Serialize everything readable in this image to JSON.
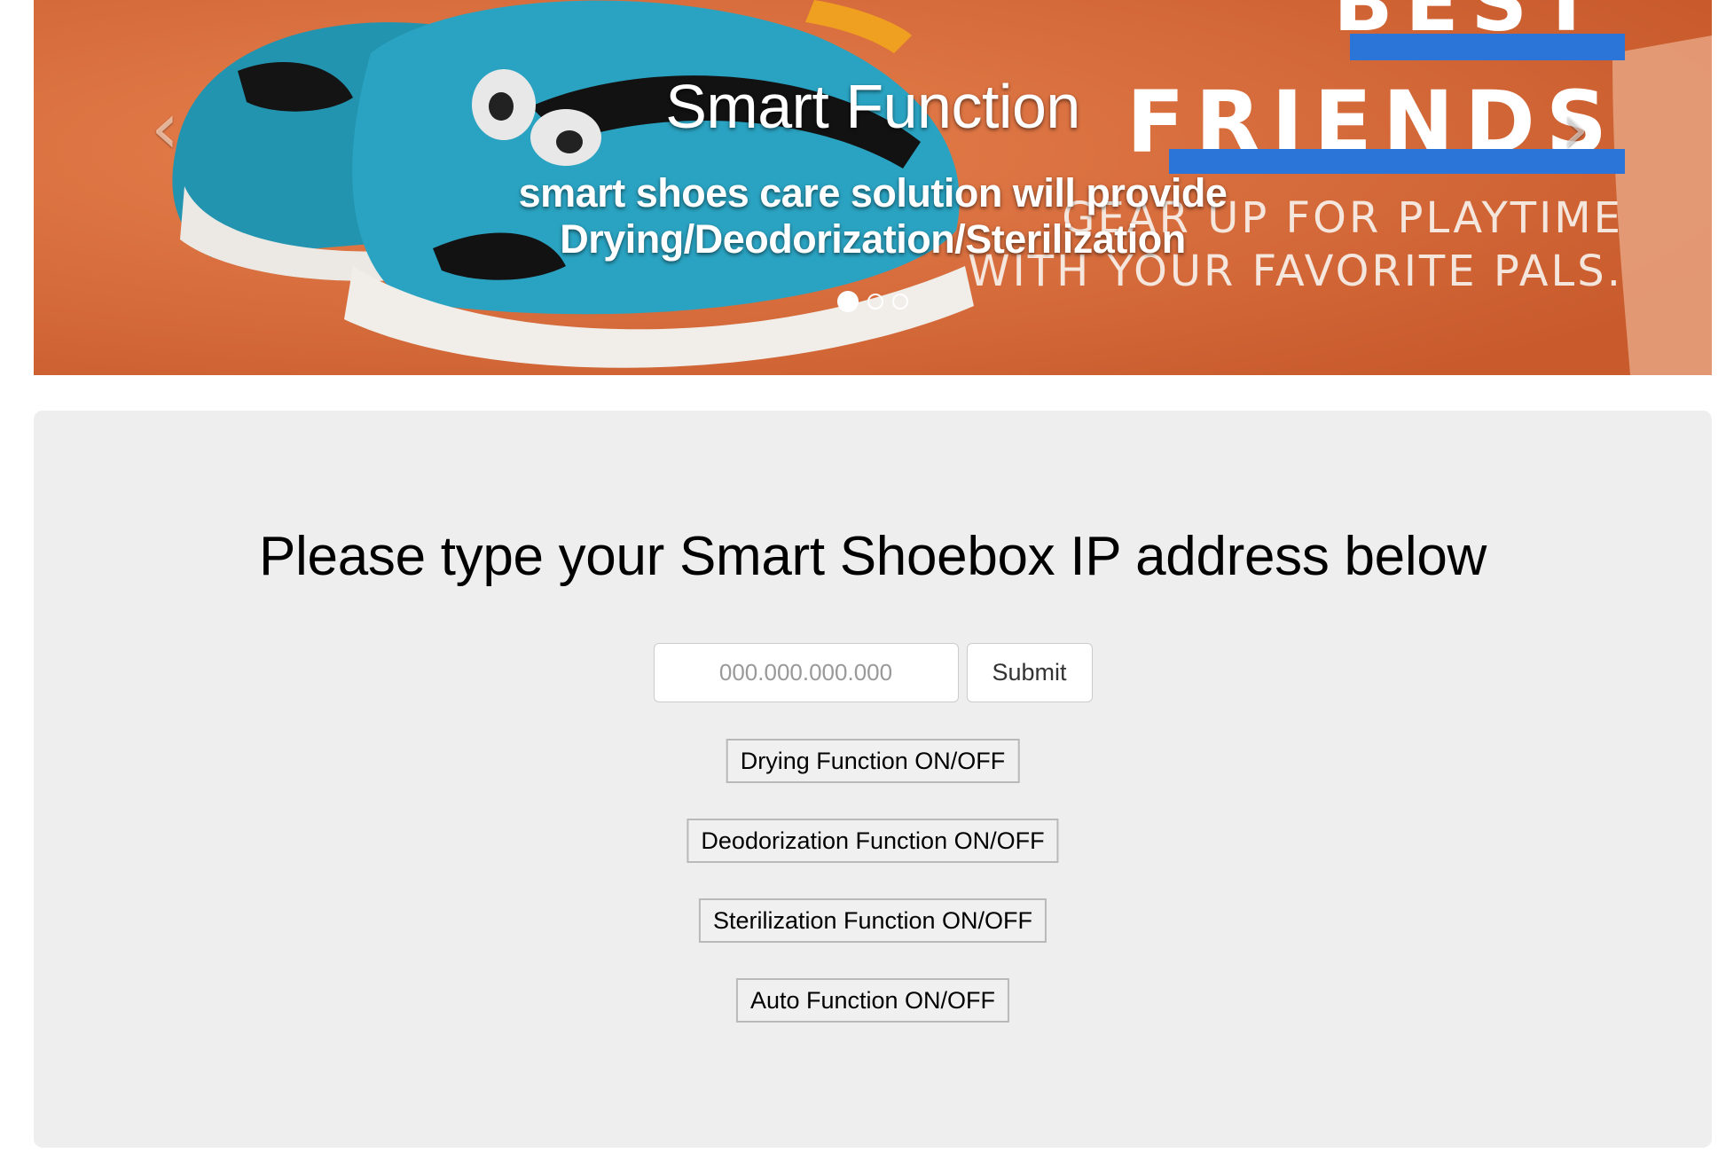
{
  "carousel": {
    "caption_title": "Smart Function",
    "caption_text_line1": "smart shoes care solution will provide",
    "caption_text_line2": "Drying/Deodorization/Sterilization",
    "poster_best": "BEST",
    "poster_friends": "FRIENDS",
    "poster_line1": "GEAR UP FOR PLAYTIME",
    "poster_line2": "WITH YOUR FAVORITE PALS.",
    "prev_icon": "‹",
    "next_icon": "›",
    "slide_count": 3,
    "active_slide": 1
  },
  "main": {
    "heading": "Please type your Smart Shoebox IP address below",
    "ip_input": {
      "placeholder": "000.000.000.000",
      "value": ""
    },
    "submit_label": "Submit",
    "functions": [
      "Drying Function ON/OFF",
      "Deodorization Function ON/OFF",
      "Sterilization Function ON/OFF",
      "Auto Function ON/OFF"
    ]
  },
  "colors": {
    "carousel_background": "#e07040",
    "poster_accent": "#2b74d8",
    "panel_background": "#eeeeee"
  }
}
